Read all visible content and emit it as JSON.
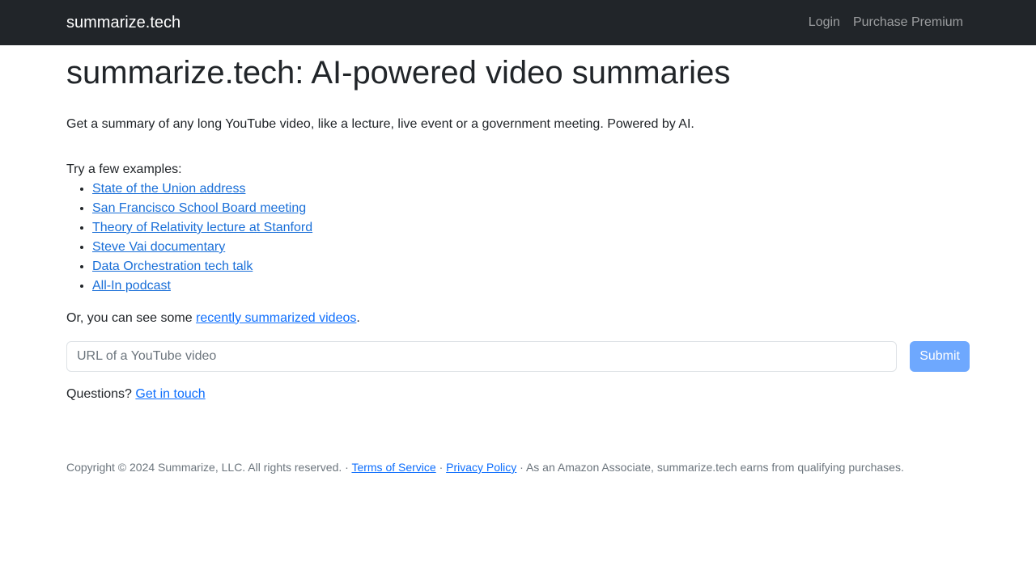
{
  "navbar": {
    "brand": "summarize.tech",
    "links": [
      {
        "label": "Login"
      },
      {
        "label": "Purchase Premium"
      }
    ]
  },
  "main": {
    "title": "summarize.tech: AI-powered video summaries",
    "lead": "Get a summary of any long YouTube video, like a lecture, live event or a government meeting. Powered by AI.",
    "examples_intro": "Try a few examples:",
    "examples": [
      {
        "label": "State of the Union address"
      },
      {
        "label": "San Francisco School Board meeting"
      },
      {
        "label": "Theory of Relativity lecture at Stanford"
      },
      {
        "label": "Steve Vai documentary"
      },
      {
        "label": "Data Orchestration tech talk"
      },
      {
        "label": "All-In podcast"
      }
    ],
    "recent_prefix": "Or, you can see some ",
    "recent_link": "recently summarized videos",
    "recent_suffix": ".",
    "url_placeholder": "URL of a YouTube video",
    "url_value": "",
    "submit_label": "Submit",
    "questions_prefix": "Questions? ",
    "questions_link": "Get in touch"
  },
  "footer": {
    "copyright": "Copyright © 2024 Summarize, LLC. All rights reserved. · ",
    "terms": "Terms of Service",
    "sep": " · ",
    "privacy": "Privacy Policy",
    "amazon": " · As an Amazon Associate, summarize.tech earns from qualifying purchases."
  }
}
